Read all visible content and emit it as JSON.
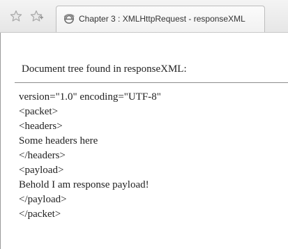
{
  "browser": {
    "tab_title": "Chapter 3 : XMLHttpRequest - responseXML",
    "icons": {
      "favorites_star": "star-outline-icon",
      "add_favorites": "star-plus-icon",
      "page": "ie-page-icon"
    }
  },
  "page": {
    "heading": "Document tree found in responseXML:",
    "lines": [
      "version=\"1.0\" encoding=\"UTF-8\"",
      "<packet>",
      "<headers>",
      "Some headers here",
      "</headers>",
      "<payload>",
      "Behold I am response payload!",
      "</payload>",
      "</packet>"
    ]
  }
}
